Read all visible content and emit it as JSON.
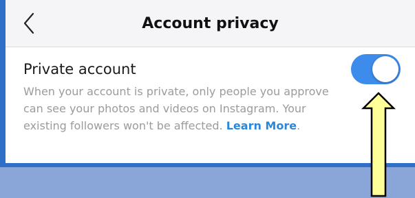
{
  "colors": {
    "frame_accent": "#2f6fc7",
    "backdrop": "#8aa6d8",
    "toggle_on": "#3d8bea",
    "link": "#2d87d8",
    "annotation_arrow_fill": "#ffff99"
  },
  "header": {
    "title": "Account privacy",
    "back_icon": "chevron-left-icon"
  },
  "setting": {
    "label": "Private account",
    "description": "When your account is private, only people you approve can see your photos and videos on Instagram. Your existing followers won't be affected.",
    "link_text": "Learn More",
    "trailing_punctuation": ".",
    "toggle_state": "on"
  },
  "annotation": {
    "icon": "up-arrow-icon"
  }
}
